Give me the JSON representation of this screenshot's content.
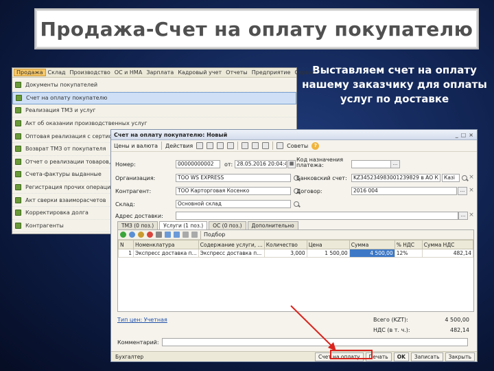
{
  "slide": {
    "title": "Продажа-Счет на оплату покупателю",
    "description": "Выставляем счет на оплату нашему заказчику для оплаты услуг по доставке"
  },
  "back_window": {
    "menu": [
      "Продажа",
      "Склад",
      "Производство",
      "ОС и НМА",
      "Зарплата",
      "Кадровый учет",
      "Отчеты",
      "Предприятие",
      "Сервис"
    ],
    "items": [
      "Документы покупателей",
      "Счет на оплату покупателю",
      "Реализация ТМЗ и услуг",
      "Акт об оказании производственных услуг",
      "Оптовая реализация с сертификатом",
      "Возврат ТМЗ от покупателя",
      "Отчет о реализации товаров, принятых на комиссию",
      "Счета-фактуры выданные",
      "Регистрация прочих операций по приобретению",
      "Акт сверки взаиморасчетов",
      "Корректировка долга",
      "Контрагенты"
    ]
  },
  "doc": {
    "window_title": "Счет на оплату покупателю: Новый",
    "toolbar": {
      "prices": "Цены и валюта",
      "actions": "Действия",
      "tips": "Советы"
    },
    "number_label": "Номер:",
    "number_value": "00000000002",
    "date_label": "от:",
    "date_value": "28.05.2016 20:04:41",
    "org_label": "Организация:",
    "org_value": "ТОО WS EXPRESS",
    "counterparty_label": "Контрагент:",
    "counterparty_value": "ТОО Карторговая Косенко",
    "warehouse_label": "Склад:",
    "warehouse_value": "Основной склад",
    "address_label": "Адрес доставки:",
    "bank_account_label": "Код назначения платежа:",
    "bank_label": "Банковский счет:",
    "bank_value": "KZ345234983001239829 в АО К",
    "bank_tail": "Казі",
    "contract_label": "Договор:",
    "contract_value": "2016 004",
    "tabs": [
      "ТМЗ (0 поз.)",
      "Услуги (1 поз.)",
      "ОС (0 поз.)",
      "Дополнительно"
    ],
    "table_toolbar_label": "Подбор",
    "columns": [
      "N",
      "Номенклатура",
      "Содержание услуги, ...",
      "Количество",
      "Цена",
      "Сумма",
      "% НДС",
      "Сумма НДС"
    ],
    "rows": [
      [
        "1",
        "Экспресс доставка п...",
        "Экспресс доставка п...",
        "3,000",
        "1 500,00",
        "4 500,00",
        "12%",
        "482,14"
      ]
    ],
    "price_type_label": "Тип цен: Учетная",
    "total_label": "Всего (KZT):",
    "total_value": "4 500,00",
    "vat_label": "НДС (в т. ч.):",
    "vat_value": "482,14",
    "comment_label": "Комментарий:",
    "footer": {
      "accountant": "Бухгалтер",
      "invoice_button": "Счет на оплату",
      "print": "Печать",
      "ok": "OK",
      "write": "Записать",
      "close": "Закрыть"
    }
  },
  "colors": {
    "highlight": "#d9231c",
    "selection": "#3c78c6"
  }
}
